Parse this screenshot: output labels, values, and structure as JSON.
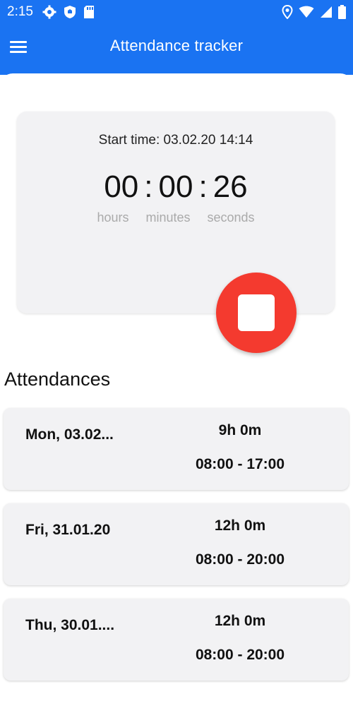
{
  "status_bar": {
    "time": "2:15"
  },
  "app_bar": {
    "title": "Attendance tracker"
  },
  "timer": {
    "start_time_label": "Start time: 03.02.20 14:14",
    "hours": "00",
    "minutes": "00",
    "seconds": "26",
    "separator": ":",
    "hours_label": "hours",
    "minutes_label": "minutes",
    "seconds_label": "seconds"
  },
  "attendances": {
    "title": "Attendances",
    "items": [
      {
        "date": "Mon, 03.02...",
        "duration": "9h 0m",
        "range": "08:00 - 17:00"
      },
      {
        "date": "Fri, 31.01.20",
        "duration": "12h 0m",
        "range": "08:00 - 20:00"
      },
      {
        "date": "Thu, 30.01....",
        "duration": "12h 0m",
        "range": "08:00 - 20:00"
      }
    ]
  },
  "colors": {
    "primary": "#1a73f2",
    "stop": "#f43a2f",
    "card": "#f2f2f4"
  }
}
